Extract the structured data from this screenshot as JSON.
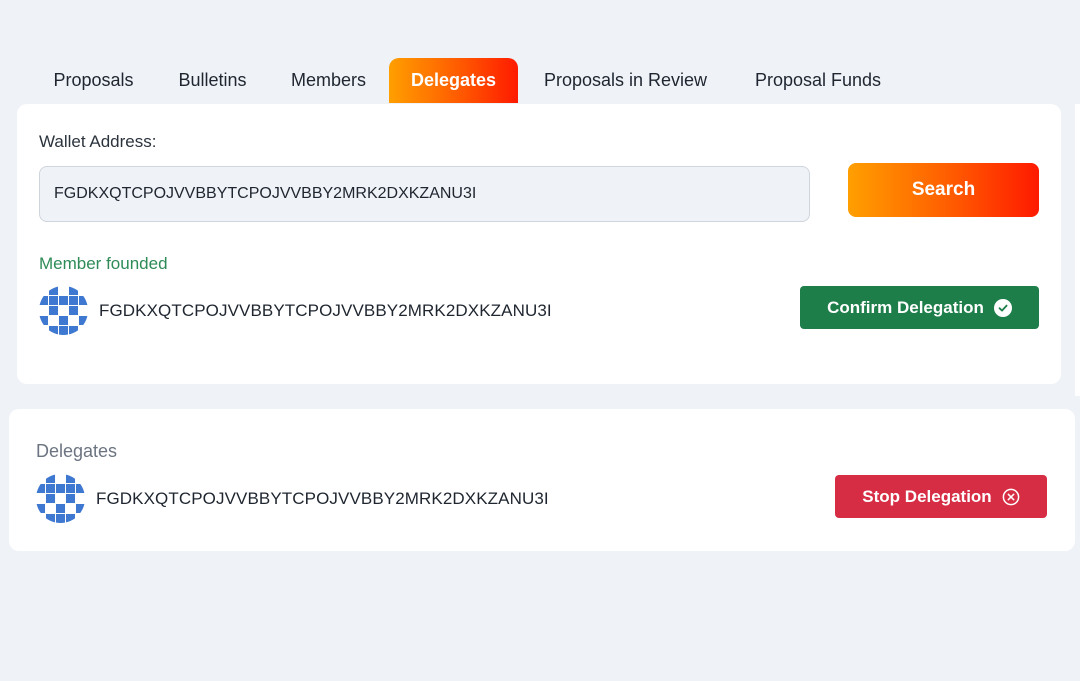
{
  "tabs": [
    {
      "label": "Proposals",
      "active": false
    },
    {
      "label": "Bulletins",
      "active": false
    },
    {
      "label": "Members",
      "active": false
    },
    {
      "label": "Delegates",
      "active": true
    },
    {
      "label": "Proposals in Review",
      "active": false
    },
    {
      "label": "Proposal Funds",
      "active": false
    }
  ],
  "search": {
    "label": "Wallet Address:",
    "value": "FGDKXQTCPOJVVBBYTCPOJVVBBY2MRK2DXKZANU3I",
    "placeholder": "",
    "button_label": "Search"
  },
  "result": {
    "status": "Member founded",
    "address": "FGDKXQTCPOJVVBBYTCPOJVVBBY2MRK2DXKZANU3I",
    "avatar_icon": "identicon",
    "confirm_label": "Confirm Delegation",
    "confirm_icon": "check-circle-icon"
  },
  "delegates": {
    "title": "Delegates",
    "items": [
      {
        "address": "FGDKXQTCPOJVVBBYTCPOJVVBBY2MRK2DXKZANU3I",
        "avatar_icon": "identicon",
        "stop_label": "Stop Delegation",
        "stop_icon": "close-circle-icon"
      }
    ]
  },
  "colors": {
    "accent_gradient_start": "#ff9f00",
    "accent_gradient_end": "#ff1a00",
    "success": "#1e7e4a",
    "success_text": "#2e8b57",
    "danger": "#d62d44",
    "identicon": "#3f78d1",
    "background": "#eff2f7"
  }
}
